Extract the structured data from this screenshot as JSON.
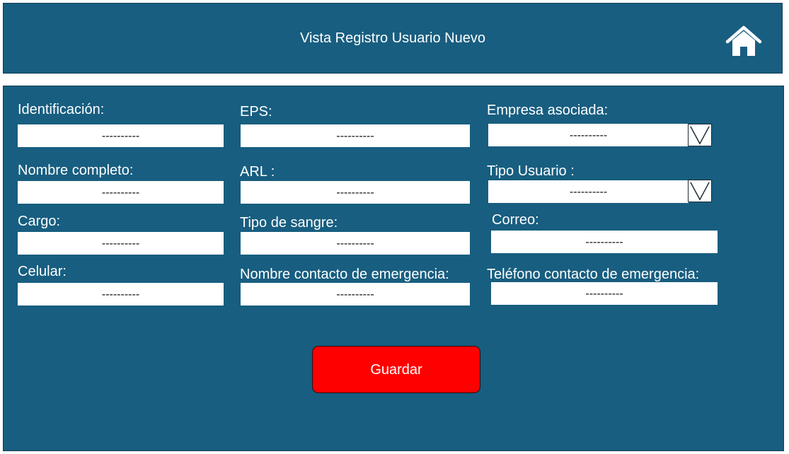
{
  "header": {
    "title": "Vista Registro Usuario Nuevo"
  },
  "form": {
    "identificacion": {
      "label": "Identificación:",
      "value": "----------"
    },
    "nombre_completo": {
      "label": "Nombre completo:",
      "value": "----------"
    },
    "cargo": {
      "label": "Cargo:",
      "value": "----------"
    },
    "celular": {
      "label": "Celular:",
      "value": "----------"
    },
    "eps": {
      "label": "EPS:",
      "value": "----------"
    },
    "arl": {
      "label": "ARL :",
      "value": "----------"
    },
    "tipo_sangre": {
      "label": "Tipo de sangre:",
      "value": "----------"
    },
    "nombre_contacto": {
      "label": "Nombre contacto de emergencia:",
      "value": "----------"
    },
    "empresa": {
      "label": "Empresa asociada:",
      "value": "----------"
    },
    "tipo_usuario": {
      "label": "Tipo Usuario :",
      "value": "----------"
    },
    "correo": {
      "label": "Correo:",
      "value": "----------"
    },
    "telefono_contacto": {
      "label": "Teléfono contacto de emergencia:",
      "value": "----------"
    }
  },
  "actions": {
    "save_label": "Guardar"
  },
  "icons": {
    "home": "home-icon",
    "dropdown": "chevron-down-icon"
  },
  "colors": {
    "background": "#185e80",
    "save_button": "#ff0000",
    "text": "#ffffff"
  }
}
